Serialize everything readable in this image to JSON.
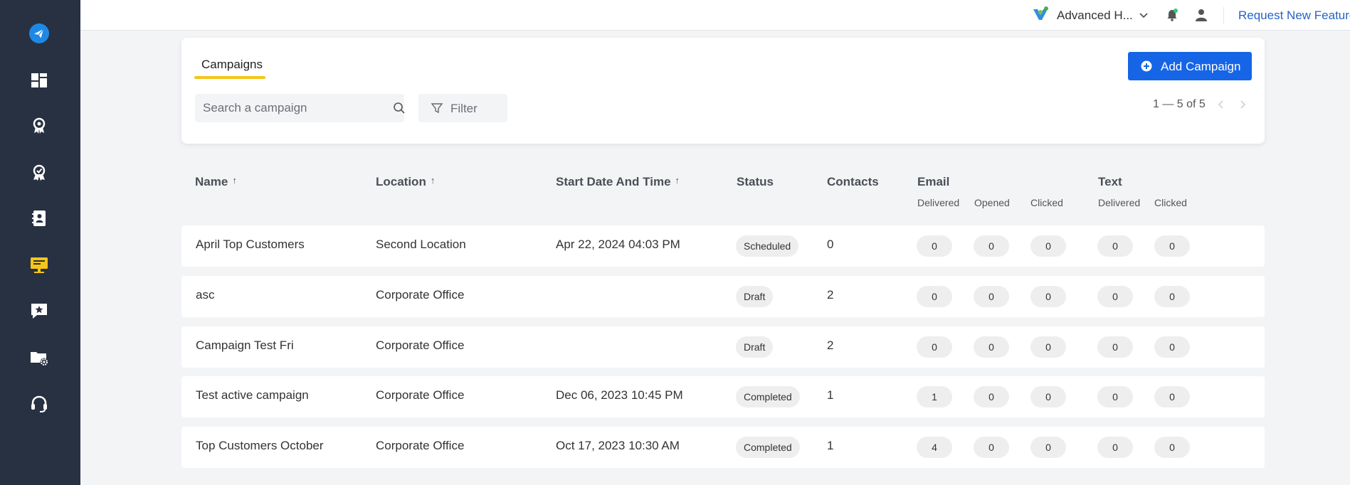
{
  "topbar": {
    "account_name": "Advanced H...",
    "request_feature": "Request New Feature"
  },
  "sidebar": {
    "icons": [
      "send-icon",
      "dashboard-icon",
      "award-icon",
      "badge-check-icon",
      "contacts-icon",
      "campaigns-monitor-icon",
      "review-chat-icon",
      "folder-settings-icon",
      "support-headset-icon"
    ],
    "active_color": "#f5c518"
  },
  "card": {
    "tab_label": "Campaigns",
    "search_placeholder": "Search a campaign",
    "filter_label": "Filter",
    "add_button": "Add Campaign",
    "pagination": "1 — 5 of 5"
  },
  "table": {
    "headers": {
      "name": "Name",
      "location": "Location",
      "start": "Start Date And Time",
      "status": "Status",
      "contacts": "Contacts",
      "email": "Email",
      "text": "Text",
      "sort_arrow": "↑"
    },
    "subheaders": {
      "email_delivered": "Delivered",
      "email_opened": "Opened",
      "email_clicked": "Clicked",
      "text_delivered": "Delivered",
      "text_clicked": "Clicked"
    },
    "rows": [
      {
        "name": "April Top Customers",
        "location": "Second Location",
        "start": "Apr 22, 2024 04:03 PM",
        "status": "Scheduled",
        "contacts": "0",
        "email_delivered": "0",
        "email_opened": "0",
        "email_clicked": "0",
        "text_delivered": "0",
        "text_clicked": "0"
      },
      {
        "name": "asc",
        "location": "Corporate Office",
        "start": "",
        "status": "Draft",
        "contacts": "2",
        "email_delivered": "0",
        "email_opened": "0",
        "email_clicked": "0",
        "text_delivered": "0",
        "text_clicked": "0"
      },
      {
        "name": "Campaign Test Fri",
        "location": "Corporate Office",
        "start": "",
        "status": "Draft",
        "contacts": "2",
        "email_delivered": "0",
        "email_opened": "0",
        "email_clicked": "0",
        "text_delivered": "0",
        "text_clicked": "0"
      },
      {
        "name": "Test active campaign",
        "location": "Corporate Office",
        "start": "Dec 06, 2023 10:45 PM",
        "status": "Completed",
        "contacts": "1",
        "email_delivered": "1",
        "email_opened": "0",
        "email_clicked": "0",
        "text_delivered": "0",
        "text_clicked": "0"
      },
      {
        "name": "Top Customers October",
        "location": "Corporate Office",
        "start": "Oct 17, 2023 10:30 AM",
        "status": "Completed",
        "contacts": "1",
        "email_delivered": "4",
        "email_opened": "0",
        "email_clicked": "0",
        "text_delivered": "0",
        "text_clicked": "0"
      }
    ]
  },
  "colors": {
    "sidebar_bg": "#283142",
    "primary": "#1565e6",
    "tab_underline": "#f5c518",
    "link": "#2563c9"
  }
}
